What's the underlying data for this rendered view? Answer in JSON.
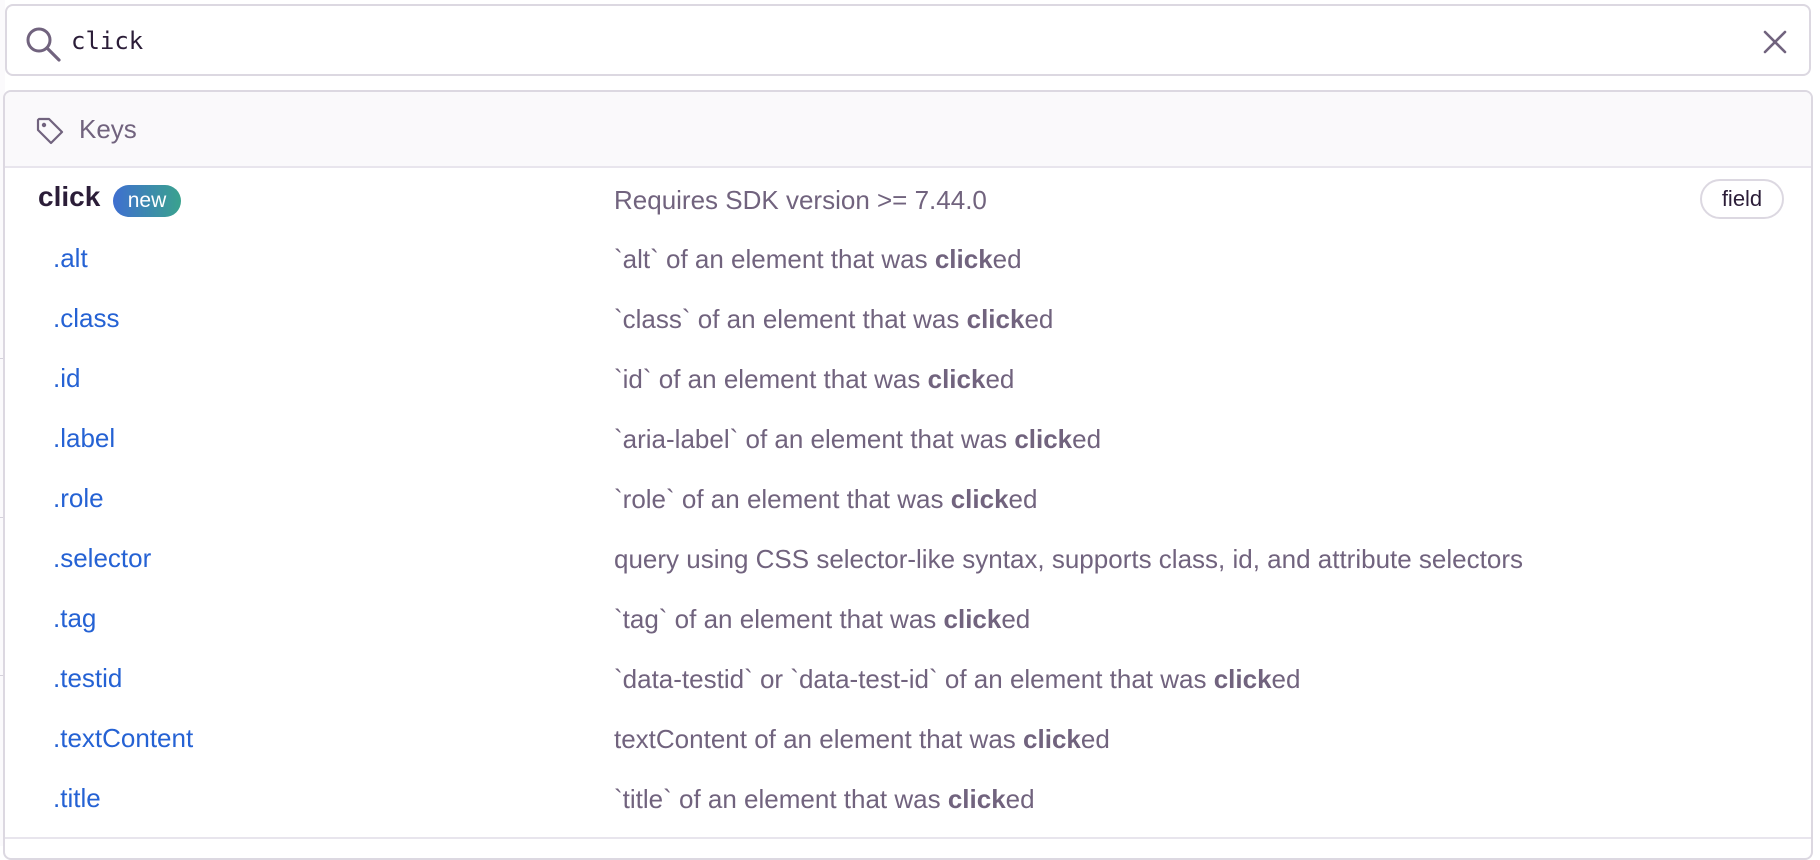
{
  "search": {
    "value": "click"
  },
  "dropdown": {
    "header_label": "Keys",
    "parent": {
      "key": "click",
      "badge": "new",
      "description": "Requires SDK version >= 7.44.0",
      "kind": "field"
    },
    "items": [
      {
        "key": ".alt",
        "desc_before": "`alt` of an element that was ",
        "match": "click",
        "desc_after": "ed"
      },
      {
        "key": ".class",
        "desc_before": "`class` of an element that was ",
        "match": "click",
        "desc_after": "ed"
      },
      {
        "key": ".id",
        "desc_before": "`id` of an element that was ",
        "match": "click",
        "desc_after": "ed"
      },
      {
        "key": ".label",
        "desc_before": "`aria-label` of an element that was ",
        "match": "click",
        "desc_after": "ed"
      },
      {
        "key": ".role",
        "desc_before": "`role` of an element that was ",
        "match": "click",
        "desc_after": "ed"
      },
      {
        "key": ".selector",
        "desc_before": "query using CSS selector-like syntax, supports class, id, and attribute selectors",
        "match": "",
        "desc_after": ""
      },
      {
        "key": ".tag",
        "desc_before": "`tag` of an element that was ",
        "match": "click",
        "desc_after": "ed"
      },
      {
        "key": ".testid",
        "desc_before": "`data-testid` or `data-test-id` of an element that was ",
        "match": "click",
        "desc_after": "ed"
      },
      {
        "key": ".textContent",
        "desc_before": "textContent of an element that was ",
        "match": "click",
        "desc_after": "ed"
      },
      {
        "key": ".title",
        "desc_before": "`title` of an element that was ",
        "match": "click",
        "desc_after": "ed"
      }
    ]
  },
  "colors": {
    "key_link": "#2562d4",
    "muted_text": "#71637e",
    "heading_text": "#2b1d38",
    "border": "#dcd8e1"
  },
  "icons": [
    "search-icon",
    "clear-icon",
    "tag-icon"
  ]
}
